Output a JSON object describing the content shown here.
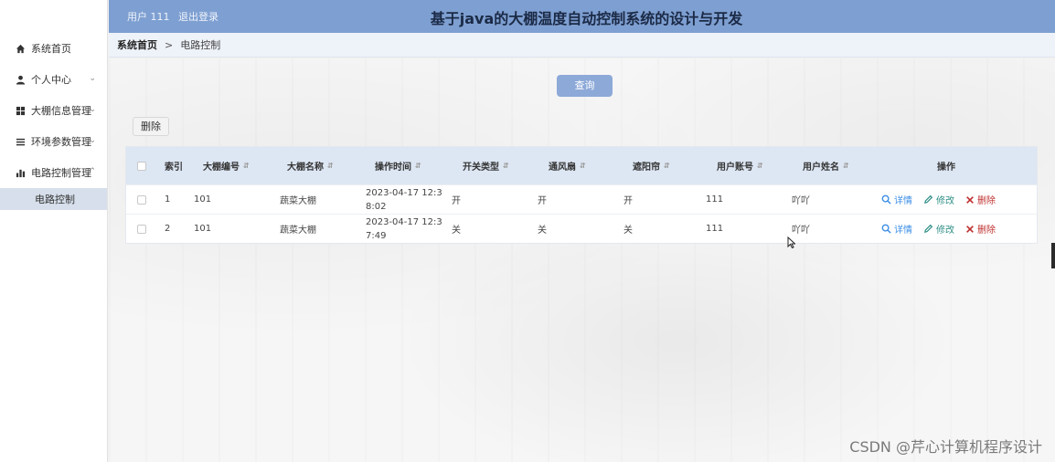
{
  "header": {
    "user_label": "用户 111",
    "logout_label": "退出登录",
    "title": "基于java的大棚温度自动控制系统的设计与开发"
  },
  "sidebar": {
    "items": [
      {
        "label": "系统首页",
        "icon": "home-icon"
      },
      {
        "label": "个人中心",
        "icon": "user-icon"
      },
      {
        "label": "大棚信息管理",
        "icon": "grid-icon"
      },
      {
        "label": "环境参数管理",
        "icon": "list-icon"
      },
      {
        "label": "电路控制管理",
        "icon": "bar-chart-icon"
      }
    ],
    "subitem": {
      "label": "电路控制"
    }
  },
  "breadcrumb": {
    "home": "系统首页",
    "separator": ">",
    "current": "电路控制"
  },
  "toolbar": {
    "query_label": "查询",
    "delete_label": "删除"
  },
  "table": {
    "headers": {
      "index": "索引",
      "greenhouse_no": "大棚编号",
      "greenhouse_name": "大棚名称",
      "op_time": "操作时间",
      "switch_type": "开关类型",
      "fan": "通风扇",
      "shade": "遮阳帘",
      "account": "用户账号",
      "username": "用户姓名",
      "ops": "操作"
    },
    "rows": [
      {
        "index": "1",
        "greenhouse_no": "101",
        "greenhouse_name": "蔬菜大棚",
        "op_time_1": "2023-04-17 12:3",
        "op_time_2": "8:02",
        "switch_type": "开",
        "fan": "开",
        "shade": "开",
        "account": "111",
        "username": "吖吖"
      },
      {
        "index": "2",
        "greenhouse_no": "101",
        "greenhouse_name": "蔬菜大棚",
        "op_time_1": "2023-04-17 12:3",
        "op_time_2": "7:49",
        "switch_type": "关",
        "fan": "关",
        "shade": "关",
        "account": "111",
        "username": "吖吖"
      }
    ],
    "actions": {
      "detail": "详情",
      "edit": "修改",
      "delete": "删除"
    }
  },
  "watermark": "CSDN @芹心计算机程序设计",
  "colors": {
    "header_bg": "#7e9fd1",
    "query_btn": "#8ca9d8",
    "table_head": "#dde6f3",
    "detail": "#3a8ee6",
    "edit": "#2f8f86",
    "delete": "#c03030"
  }
}
